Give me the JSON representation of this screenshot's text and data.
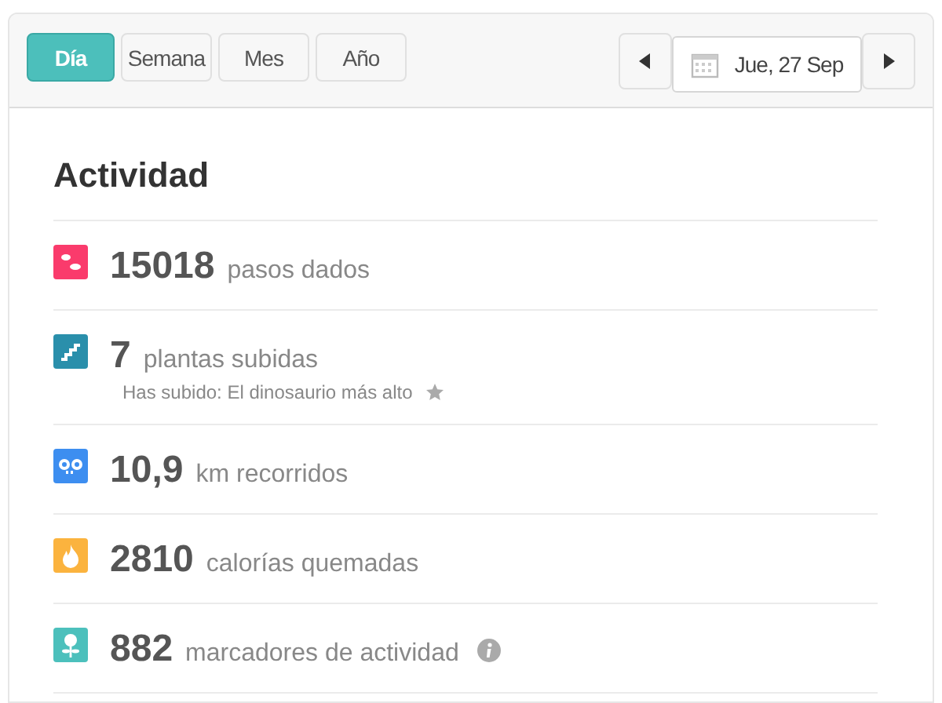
{
  "tabs": [
    {
      "label": "Día",
      "selected": true
    },
    {
      "label": "Semana",
      "selected": false
    },
    {
      "label": "Mes",
      "selected": false
    },
    {
      "label": "Año",
      "selected": false
    }
  ],
  "date": "Jue, 27 Sep",
  "title": "Actividad",
  "stats": [
    {
      "kind": "steps",
      "color": "#fa3b6c",
      "value": "15018",
      "label": "pasos dados"
    },
    {
      "kind": "floors",
      "color": "#2a8fab",
      "value": "7",
      "label": "plantas subidas",
      "badge": "Has subido: El dinosaurio más alto"
    },
    {
      "kind": "distance",
      "color": "#3d8ef0",
      "value": "10,9",
      "label": "km recorridos"
    },
    {
      "kind": "calories",
      "color": "#fbb33e",
      "value": "2810",
      "label": "calorías quemadas"
    },
    {
      "kind": "active",
      "color": "#4cc0bc",
      "value": "882",
      "label": "marcadores de actividad",
      "info": true
    }
  ]
}
